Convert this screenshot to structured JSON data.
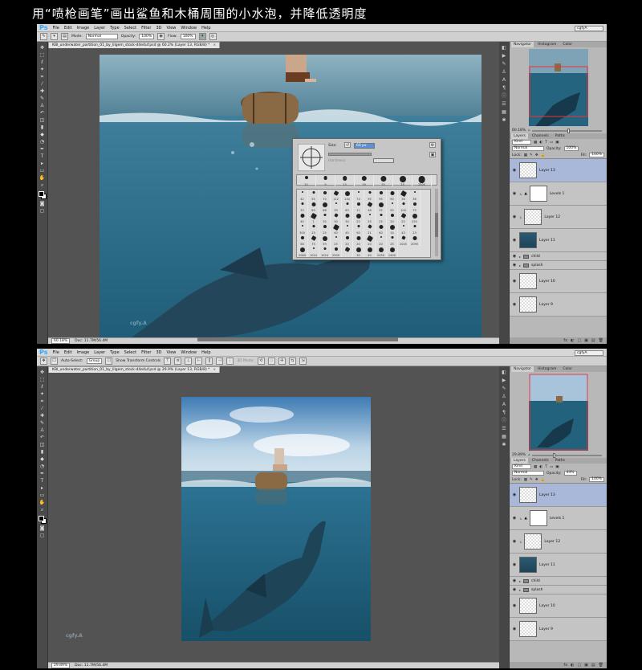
{
  "caption": "用“喷枪画笔”画出鲨鱼和木桶周围的小水泡，并降低透明度",
  "app": {
    "logo": "Ps",
    "menu": [
      "File",
      "Edit",
      "Image",
      "Layer",
      "Type",
      "Select",
      "Filter",
      "3D",
      "View",
      "Window",
      "Help"
    ],
    "workspace": "cgfyA",
    "accent": "#31a8ff"
  },
  "top": {
    "options": {
      "mode_label": "Mode:",
      "mode_value": "Normal",
      "opacity_label": "Opacity:",
      "opacity_value": "100%",
      "flow_label": "Flow:",
      "flow_value": "100%"
    },
    "doc_tab": "KBI_underwater_partition_01_by_lilgem_stock-d4e4uf.psd @ 60.2% (Layer 13, RGB/8) *",
    "status_zoom": "60.18%",
    "status_doc": "Doc: 11.7M/56.4M",
    "brush_picker": {
      "size_label": "Size:",
      "size_value": "60 px",
      "hardness_label": "Hardness:",
      "row1": [
        "24",
        "9",
        "13",
        "19",
        "70",
        "25",
        "2500"
      ],
      "rows": [
        [
          "42",
          "55",
          "70",
          "112",
          "134",
          "74",
          "95",
          "95",
          "90",
          "36",
          "36",
          "33"
        ],
        [
          "63",
          "66",
          "39",
          "63",
          "11",
          "48",
          "32",
          "55",
          "100",
          "75",
          "45",
          "1"
        ],
        [
          "30",
          "30",
          "30",
          "20",
          "25",
          "25",
          "20",
          "20",
          "250",
          "300",
          "25",
          "25"
        ],
        [
          "40",
          "45",
          "90",
          "21",
          "60",
          "14",
          "43",
          "23",
          "58",
          "75",
          "59",
          "25"
        ],
        [
          "20",
          "20",
          "20",
          "20",
          "25",
          "2045",
          "2090",
          "2069",
          "1024",
          "1024",
          "2500",
          ""
        ]
      ],
      "last_row": [
        "30",
        "40",
        "2450",
        "2400"
      ]
    },
    "navigator": {
      "tabs": [
        "Navigator",
        "Histogram",
        "Color"
      ],
      "zoom": "60.18%"
    },
    "layers": {
      "tabs": [
        "Layers",
        "Channels",
        "Paths"
      ],
      "kind": "Kind",
      "blend": "Normal",
      "opacity_label": "Opacity:",
      "opacity": "100%",
      "lock_label": "Lock:",
      "fill_label": "Fill:",
      "fill": "100%",
      "items": [
        {
          "name": "Layer 13",
          "selected": true,
          "thumb": "trans",
          "type": "layer"
        },
        {
          "name": "Levels 1",
          "selected": false,
          "thumb": "white",
          "type": "adjust"
        },
        {
          "name": "Layer 12",
          "selected": false,
          "thumb": "trans",
          "type": "layer"
        },
        {
          "name": "Layer 11",
          "selected": false,
          "thumb": "dark",
          "type": "layer"
        },
        {
          "name": "child",
          "selected": false,
          "thumb": "",
          "type": "folder"
        },
        {
          "name": "splash",
          "selected": false,
          "thumb": "",
          "type": "folder"
        },
        {
          "name": "Layer 10",
          "selected": false,
          "thumb": "trans",
          "type": "layer"
        },
        {
          "name": "Layer 9",
          "selected": false,
          "thumb": "trans",
          "type": "layer"
        }
      ],
      "bottom_icons": [
        "fx",
        "◐",
        "▢",
        "▣",
        "▤",
        "🗑"
      ]
    }
  },
  "bottom": {
    "options": {
      "auto_select_label": "Auto-Select:",
      "auto_select_value": "Group",
      "transform_label": "Show Transform Controls",
      "mode_3d": "3D Mode:"
    },
    "doc_tab": "KBI_underwater_partition_01_by_lilgem_stock-d4e4uf.psd @ 29.9% (Layer 13, RGB/8) *",
    "status_zoom": "29.89%",
    "status_doc": "Doc: 11.7M/56.4M",
    "navigator": {
      "tabs": [
        "Navigator",
        "Histogram",
        "Color"
      ],
      "zoom": "29.89%"
    },
    "layers": {
      "tabs": [
        "Layers",
        "Channels",
        "Paths"
      ],
      "kind": "Kind",
      "blend": "Normal",
      "opacity_label": "Opacity:",
      "opacity": "44%",
      "lock_label": "Lock:",
      "fill_label": "Fill:",
      "fill": "100%",
      "items": [
        {
          "name": "Layer 13",
          "selected": true,
          "thumb": "trans",
          "type": "layer"
        },
        {
          "name": "Levels 1",
          "selected": false,
          "thumb": "white",
          "type": "adjust"
        },
        {
          "name": "Layer 12",
          "selected": false,
          "thumb": "trans",
          "type": "layer"
        },
        {
          "name": "Layer 11",
          "selected": false,
          "thumb": "dark",
          "type": "layer"
        },
        {
          "name": "child",
          "selected": false,
          "thumb": "",
          "type": "folder"
        },
        {
          "name": "splash",
          "selected": false,
          "thumb": "",
          "type": "folder"
        },
        {
          "name": "Layer 10",
          "selected": false,
          "thumb": "trans",
          "type": "layer"
        },
        {
          "name": "Layer 9",
          "selected": false,
          "thumb": "trans",
          "type": "layer"
        }
      ],
      "bottom_icons": [
        "fx",
        "◐",
        "▢",
        "▣",
        "▤",
        "🗑"
      ]
    }
  },
  "watermark": "cgfy.A"
}
